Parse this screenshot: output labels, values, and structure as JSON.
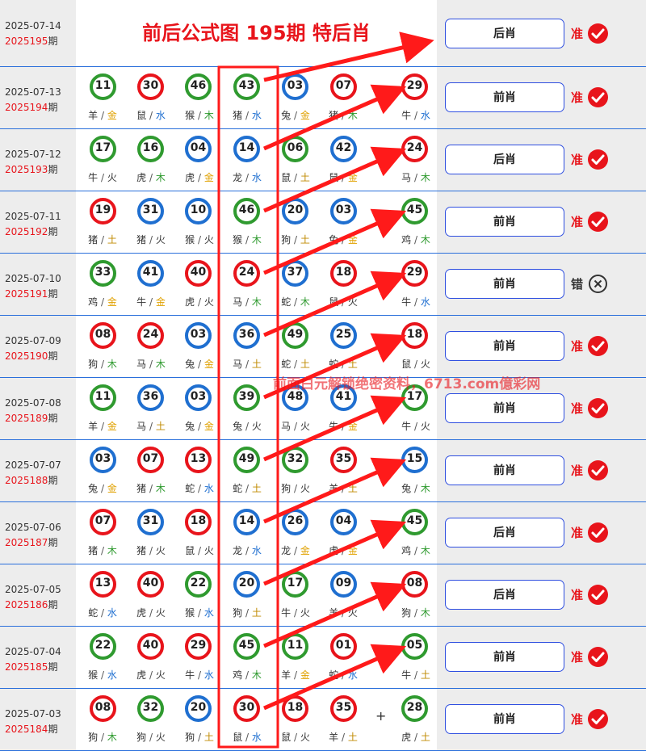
{
  "title": "前后公式图 195期 特后肖",
  "qi_suffix": "期",
  "watermark": "前面白元解锁绝密资料，6713.com億彩网",
  "current": {
    "date": "2025-07-14",
    "issue": "2025195",
    "button": "后肖",
    "status": "准",
    "correct": true
  },
  "rows": [
    {
      "date": "2025-07-13",
      "issue": "2025194",
      "button": "前肖",
      "status": "准",
      "correct": true,
      "balls": [
        {
          "n": "11",
          "z": "羊",
          "e": "金",
          "c": "green"
        },
        {
          "n": "30",
          "z": "鼠",
          "e": "水",
          "c": "red"
        },
        {
          "n": "46",
          "z": "猴",
          "e": "木",
          "c": "green"
        },
        {
          "n": "43",
          "z": "猪",
          "e": "水",
          "c": "green"
        },
        {
          "n": "03",
          "z": "兔",
          "e": "金",
          "c": "blue"
        },
        {
          "n": "07",
          "z": "猪",
          "e": "木",
          "c": "red"
        },
        {
          "n": "29",
          "z": "牛",
          "e": "水",
          "c": "red"
        }
      ]
    },
    {
      "date": "2025-07-12",
      "issue": "2025193",
      "button": "后肖",
      "status": "准",
      "correct": true,
      "balls": [
        {
          "n": "17",
          "z": "牛",
          "e": "火",
          "c": "green"
        },
        {
          "n": "16",
          "z": "虎",
          "e": "木",
          "c": "green"
        },
        {
          "n": "04",
          "z": "虎",
          "e": "金",
          "c": "blue"
        },
        {
          "n": "14",
          "z": "龙",
          "e": "水",
          "c": "blue"
        },
        {
          "n": "06",
          "z": "鼠",
          "e": "土",
          "c": "green"
        },
        {
          "n": "42",
          "z": "鼠",
          "e": "金",
          "c": "blue"
        },
        {
          "n": "24",
          "z": "马",
          "e": "木",
          "c": "red"
        }
      ]
    },
    {
      "date": "2025-07-11",
      "issue": "2025192",
      "button": "前肖",
      "status": "准",
      "correct": true,
      "balls": [
        {
          "n": "19",
          "z": "猪",
          "e": "土",
          "c": "red"
        },
        {
          "n": "31",
          "z": "猪",
          "e": "火",
          "c": "blue"
        },
        {
          "n": "10",
          "z": "猴",
          "e": "火",
          "c": "blue"
        },
        {
          "n": "46",
          "z": "猴",
          "e": "木",
          "c": "green"
        },
        {
          "n": "20",
          "z": "狗",
          "e": "土",
          "c": "blue"
        },
        {
          "n": "03",
          "z": "兔",
          "e": "金",
          "c": "blue"
        },
        {
          "n": "45",
          "z": "鸡",
          "e": "木",
          "c": "green"
        }
      ]
    },
    {
      "date": "2025-07-10",
      "issue": "2025191",
      "button": "前肖",
      "status": "错",
      "correct": false,
      "balls": [
        {
          "n": "33",
          "z": "鸡",
          "e": "金",
          "c": "green"
        },
        {
          "n": "41",
          "z": "牛",
          "e": "金",
          "c": "blue"
        },
        {
          "n": "40",
          "z": "虎",
          "e": "火",
          "c": "red"
        },
        {
          "n": "24",
          "z": "马",
          "e": "木",
          "c": "red"
        },
        {
          "n": "37",
          "z": "蛇",
          "e": "木",
          "c": "blue"
        },
        {
          "n": "18",
          "z": "鼠",
          "e": "火",
          "c": "red"
        },
        {
          "n": "29",
          "z": "牛",
          "e": "水",
          "c": "red"
        }
      ]
    },
    {
      "date": "2025-07-09",
      "issue": "2025190",
      "button": "前肖",
      "status": "准",
      "correct": true,
      "balls": [
        {
          "n": "08",
          "z": "狗",
          "e": "木",
          "c": "red"
        },
        {
          "n": "24",
          "z": "马",
          "e": "木",
          "c": "red"
        },
        {
          "n": "03",
          "z": "兔",
          "e": "金",
          "c": "blue"
        },
        {
          "n": "36",
          "z": "马",
          "e": "土",
          "c": "blue"
        },
        {
          "n": "49",
          "z": "蛇",
          "e": "土",
          "c": "green"
        },
        {
          "n": "25",
          "z": "蛇",
          "e": "土",
          "c": "blue"
        },
        {
          "n": "18",
          "z": "鼠",
          "e": "火",
          "c": "red"
        }
      ]
    },
    {
      "date": "2025-07-08",
      "issue": "2025189",
      "button": "前肖",
      "status": "准",
      "correct": true,
      "balls": [
        {
          "n": "11",
          "z": "羊",
          "e": "金",
          "c": "green"
        },
        {
          "n": "36",
          "z": "马",
          "e": "土",
          "c": "blue"
        },
        {
          "n": "03",
          "z": "兔",
          "e": "金",
          "c": "blue"
        },
        {
          "n": "39",
          "z": "兔",
          "e": "火",
          "c": "green"
        },
        {
          "n": "48",
          "z": "马",
          "e": "火",
          "c": "blue"
        },
        {
          "n": "41",
          "z": "牛",
          "e": "金",
          "c": "blue"
        },
        {
          "n": "17",
          "z": "牛",
          "e": "火",
          "c": "green"
        }
      ]
    },
    {
      "date": "2025-07-07",
      "issue": "2025188",
      "button": "前肖",
      "status": "准",
      "correct": true,
      "balls": [
        {
          "n": "03",
          "z": "兔",
          "e": "金",
          "c": "blue"
        },
        {
          "n": "07",
          "z": "猪",
          "e": "木",
          "c": "red"
        },
        {
          "n": "13",
          "z": "蛇",
          "e": "水",
          "c": "red"
        },
        {
          "n": "49",
          "z": "蛇",
          "e": "土",
          "c": "green"
        },
        {
          "n": "32",
          "z": "狗",
          "e": "火",
          "c": "green"
        },
        {
          "n": "35",
          "z": "羊",
          "e": "土",
          "c": "red"
        },
        {
          "n": "15",
          "z": "兔",
          "e": "木",
          "c": "blue"
        }
      ]
    },
    {
      "date": "2025-07-06",
      "issue": "2025187",
      "button": "后肖",
      "status": "准",
      "correct": true,
      "balls": [
        {
          "n": "07",
          "z": "猪",
          "e": "木",
          "c": "red"
        },
        {
          "n": "31",
          "z": "猪",
          "e": "火",
          "c": "blue"
        },
        {
          "n": "18",
          "z": "鼠",
          "e": "火",
          "c": "red"
        },
        {
          "n": "14",
          "z": "龙",
          "e": "水",
          "c": "blue"
        },
        {
          "n": "26",
          "z": "龙",
          "e": "金",
          "c": "blue"
        },
        {
          "n": "04",
          "z": "虎",
          "e": "金",
          "c": "blue"
        },
        {
          "n": "45",
          "z": "鸡",
          "e": "木",
          "c": "green"
        }
      ]
    },
    {
      "date": "2025-07-05",
      "issue": "2025186",
      "button": "后肖",
      "status": "准",
      "correct": true,
      "balls": [
        {
          "n": "13",
          "z": "蛇",
          "e": "水",
          "c": "red"
        },
        {
          "n": "40",
          "z": "虎",
          "e": "火",
          "c": "red"
        },
        {
          "n": "22",
          "z": "猴",
          "e": "水",
          "c": "green"
        },
        {
          "n": "20",
          "z": "狗",
          "e": "土",
          "c": "blue"
        },
        {
          "n": "17",
          "z": "牛",
          "e": "火",
          "c": "green"
        },
        {
          "n": "09",
          "z": "羊",
          "e": "火",
          "c": "blue"
        },
        {
          "n": "08",
          "z": "狗",
          "e": "木",
          "c": "red"
        }
      ]
    },
    {
      "date": "2025-07-04",
      "issue": "2025185",
      "button": "前肖",
      "status": "准",
      "correct": true,
      "balls": [
        {
          "n": "22",
          "z": "猴",
          "e": "水",
          "c": "green"
        },
        {
          "n": "40",
          "z": "虎",
          "e": "火",
          "c": "red"
        },
        {
          "n": "29",
          "z": "牛",
          "e": "水",
          "c": "red"
        },
        {
          "n": "45",
          "z": "鸡",
          "e": "木",
          "c": "green"
        },
        {
          "n": "11",
          "z": "羊",
          "e": "金",
          "c": "green"
        },
        {
          "n": "01",
          "z": "蛇",
          "e": "水",
          "c": "red"
        },
        {
          "n": "05",
          "z": "牛",
          "e": "土",
          "c": "green"
        }
      ]
    },
    {
      "date": "2025-07-03",
      "issue": "2025184",
      "button": "前肖",
      "status": "准",
      "correct": true,
      "balls": [
        {
          "n": "08",
          "z": "狗",
          "e": "木",
          "c": "red"
        },
        {
          "n": "32",
          "z": "狗",
          "e": "火",
          "c": "green"
        },
        {
          "n": "20",
          "z": "狗",
          "e": "土",
          "c": "blue"
        },
        {
          "n": "30",
          "z": "鼠",
          "e": "水",
          "c": "red"
        },
        {
          "n": "18",
          "z": "鼠",
          "e": "火",
          "c": "red"
        },
        {
          "n": "35",
          "z": "羊",
          "e": "土",
          "c": "red"
        },
        {
          "n": "28",
          "z": "虎",
          "e": "土",
          "c": "green"
        }
      ]
    }
  ],
  "plus_sign": "+",
  "colors": {
    "red": "#e8141b",
    "blue": "#1f6fd0",
    "green": "#2f9a2f",
    "accent": "#2f4fe0"
  },
  "element_colors": {
    "金": "#e0a100",
    "木": "#2f9a2f",
    "水": "#1f6fd0",
    "火": "#333333",
    "土": "#c08a00"
  }
}
